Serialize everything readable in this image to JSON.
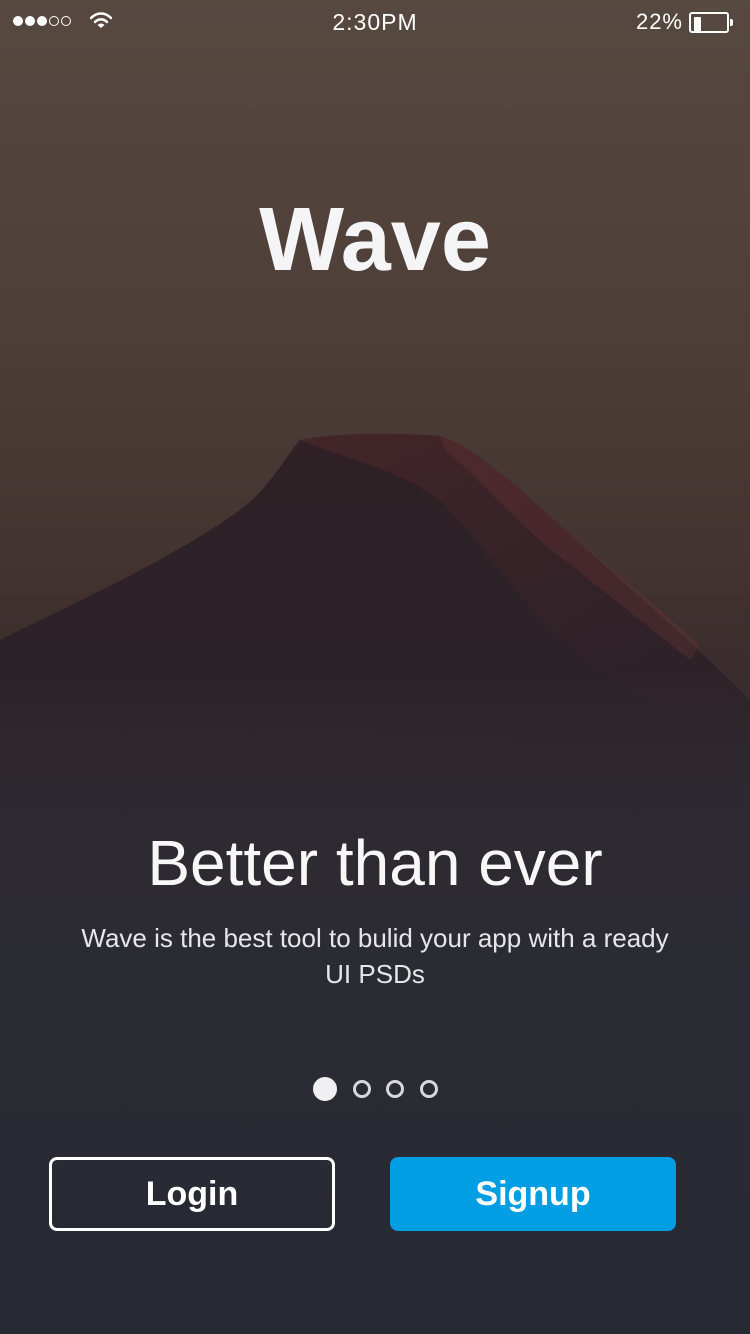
{
  "status_bar": {
    "time": "2:30PM",
    "battery_percent_label": "22%",
    "battery_level": 0.22,
    "signal_strength": 3,
    "signal_max": 5,
    "wifi_icon": "wifi-icon"
  },
  "onboarding": {
    "app_title": "Wave",
    "headline": "Better than ever",
    "description": "Wave is the best tool to bulid your app with a ready UI PSDs",
    "background": "mountain-photo",
    "page_count": 4,
    "current_page": 1
  },
  "actions": {
    "login_label": "Login",
    "signup_label": "Signup"
  },
  "colors": {
    "accent": "#029ee4",
    "text": "#ffffff",
    "background_top": "#564940",
    "background_bottom": "#272a33"
  }
}
